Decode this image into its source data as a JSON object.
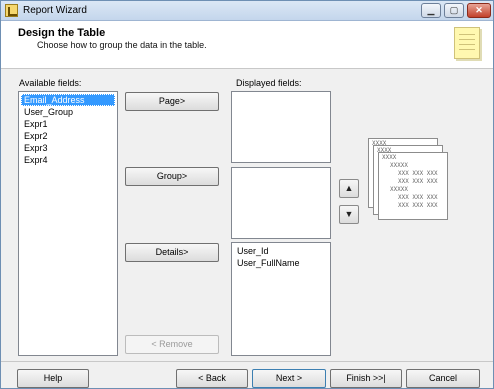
{
  "window": {
    "title": "Report Wizard"
  },
  "header": {
    "title": "Design the Table",
    "subtitle": "Choose how to group the data in the table."
  },
  "available": {
    "label": "Available fields:",
    "items": [
      "Email_Address",
      "User_Group",
      "Expr1",
      "Expr2",
      "Expr3",
      "Expr4"
    ],
    "selected": "Email_Address"
  },
  "displayed": {
    "label": "Displayed fields:",
    "page_items": [],
    "group_items": [],
    "details_items": [
      "User_Id",
      "User_FullName"
    ]
  },
  "buttons": {
    "page": "Page>",
    "group": "Group>",
    "details": "Details>",
    "remove": "< Remove",
    "help": "Help",
    "back": "< Back",
    "next": "Next >",
    "finish": "Finish >>|",
    "cancel": "Cancel"
  },
  "icons": {
    "move_up": "arrow-up-icon",
    "move_down": "arrow-down-icon"
  },
  "preview": {
    "sheet1": "XXXX",
    "sheet2": "XXXX",
    "sheet3": "XXXX",
    "row_a": "XXXXX",
    "row_b": "XXX XXX XXX",
    "row_c": "XXX XXX XXX",
    "row_d": "XXXXX",
    "row_e": "XXX XXX XXX",
    "row_f": "XXX XXX XXX"
  }
}
